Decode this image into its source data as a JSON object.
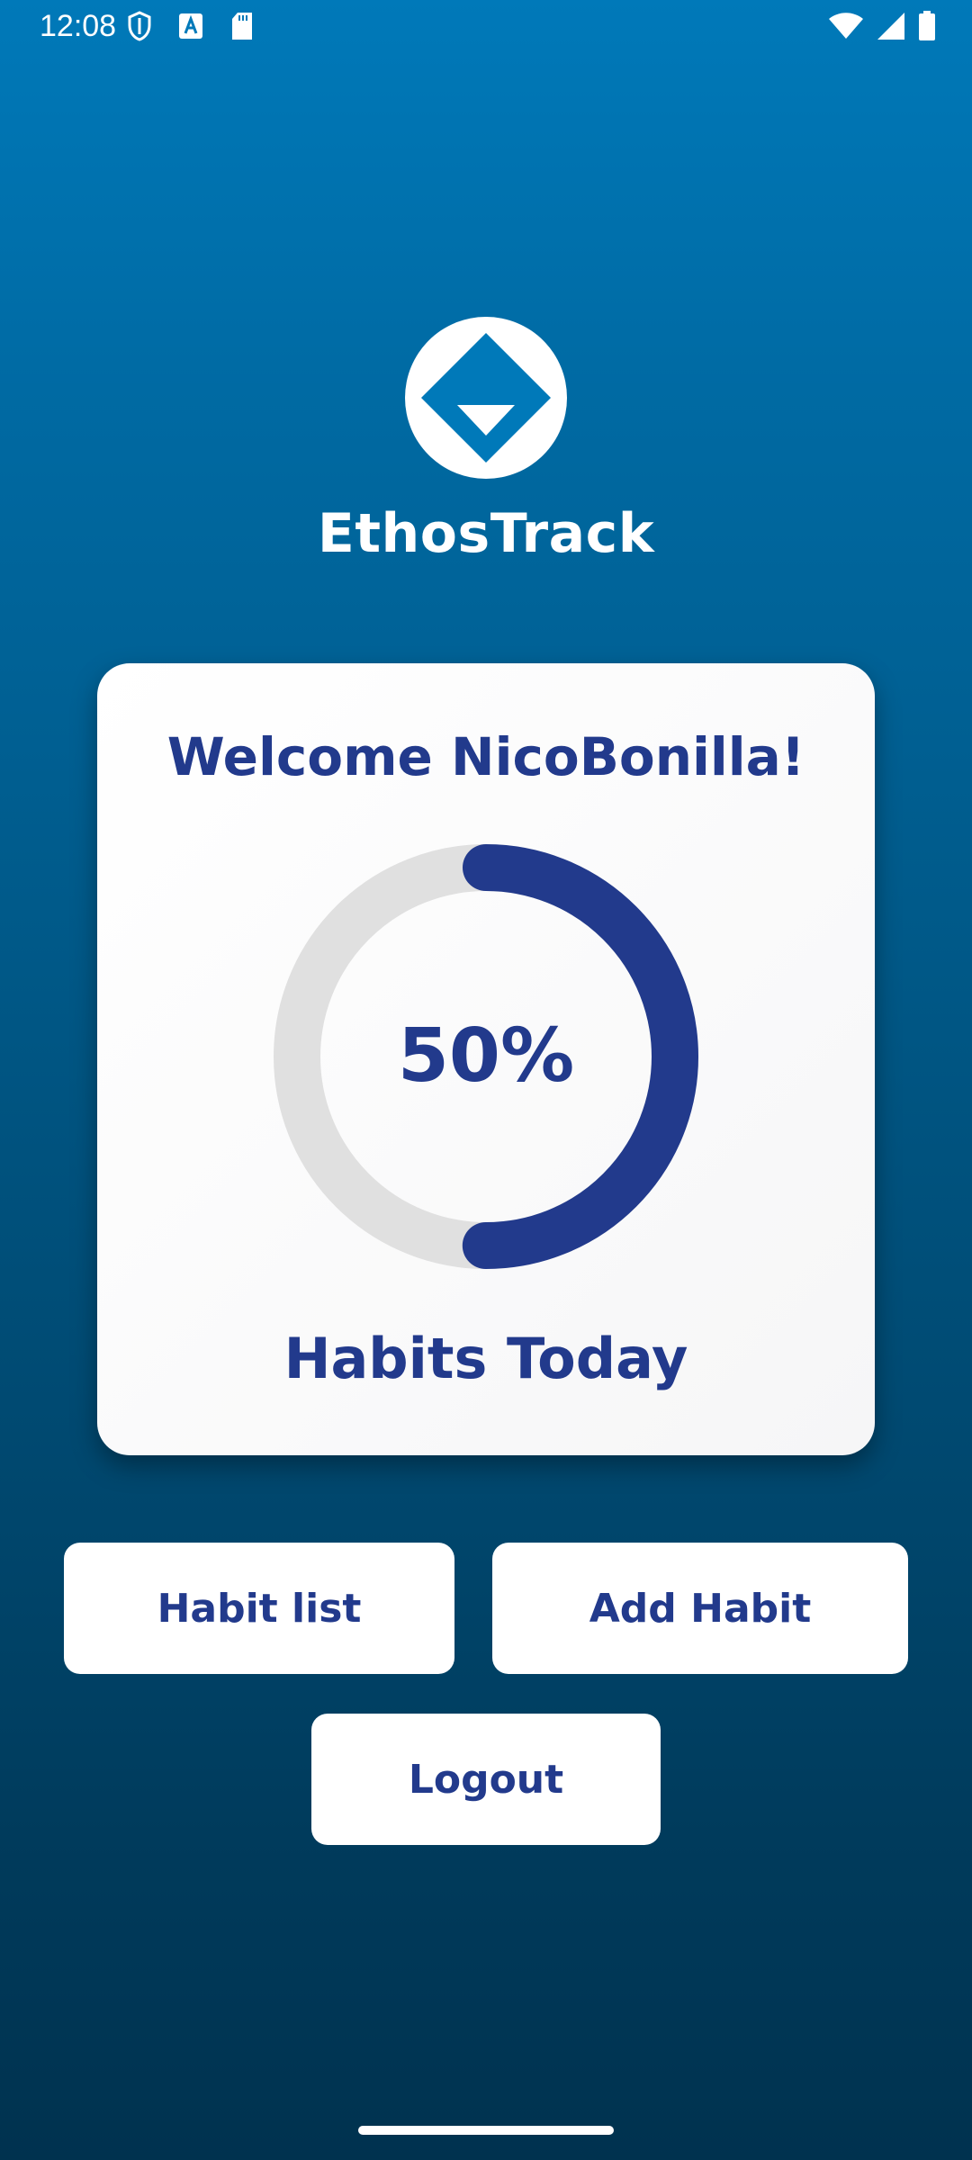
{
  "status_bar": {
    "time": "12:08",
    "left_icons": [
      "shield-icon",
      "font-a-icon",
      "sd-card-icon"
    ],
    "right_icons": [
      "wifi-icon",
      "signal-icon",
      "battery-icon"
    ]
  },
  "app": {
    "title": "EthosTrack",
    "logo_icon": "ethostrack-logo-icon"
  },
  "card": {
    "welcome_prefix": "Welcome ",
    "username": "NicoBonilla",
    "welcome_suffix": "!",
    "progress_percent": 50,
    "progress_label": "50%",
    "caption": "Habits Today"
  },
  "buttons": {
    "habit_list": "Habit list",
    "add_habit": "Add Habit",
    "logout": "Logout"
  },
  "colors": {
    "background_top": "#0079b9",
    "background_bottom": "#00324f",
    "accent": "#223a8c",
    "ring_track": "#e0e0e0",
    "card": "#ffffff"
  }
}
